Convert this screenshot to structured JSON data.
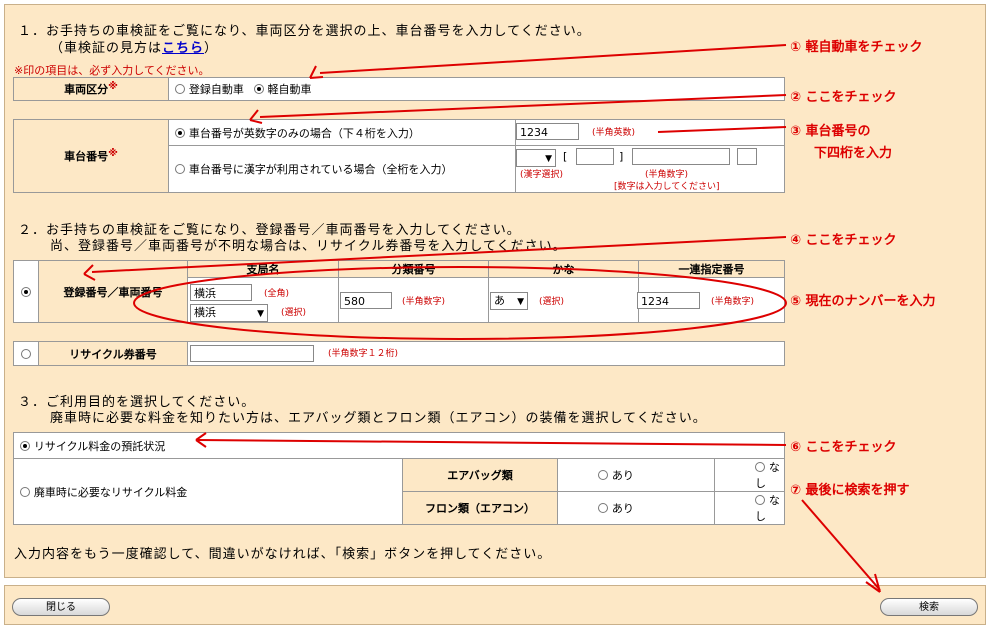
{
  "section1": {
    "title_line1": "１．お手持ちの車検証をご覧になり、車両区分を選択の上、車台番号を入力してください。",
    "title_line2_prefix": "（車検証の見方は",
    "title_line2_link": "こちら",
    "title_line2_suffix": "）",
    "required_note": "※印の項目は、必ず入力してください。",
    "vehicle_class": {
      "label": "車両区分",
      "req_mark": "※",
      "option_registered": "登録自動車",
      "option_kei": "軽自動車"
    },
    "chassis": {
      "label": "車台番号",
      "req_mark": "※",
      "option_alnum": "車台番号が英数字のみの場合（下４桁を入力）",
      "option_kanji": "車台番号に漢字が利用されている場合（全桁を入力）",
      "value": "1234",
      "hint_alnum": "(半角英数)",
      "bracket_open": "[",
      "bracket_close": "]",
      "hint_kanji": "(漢字選択)",
      "hint_numeric": "(半角数字)",
      "hint_no_char": "[数字は入力してください]"
    }
  },
  "section2": {
    "title_line1": "２．お手持ちの車検証をご覧になり、登録番号／車両番号を入力してください。",
    "title_line2": "尚、登録番号／車両番号が不明な場合は、リサイクル券番号を入力してください。",
    "reg_label": "登録番号／車両番号",
    "headers": [
      "支局名",
      "分類番号",
      "かな",
      "一連指定番号"
    ],
    "office_value": "横浜",
    "office_hint": "(全角)",
    "office_select": "横浜",
    "office_select_hint": "(選択)",
    "class_value": "580",
    "class_hint": "(半角数字)",
    "kana_select": "あ",
    "kana_hint": "(選択)",
    "serial_value": "1234",
    "serial_hint": "(半角数字)",
    "recycle_label": "リサイクル券番号",
    "recycle_hint": "(半角数字１２桁)"
  },
  "section3": {
    "title_line1": "３．ご利用目的を選択してください。",
    "title_line2": "廃車時に必要な料金を知りたい方は、エアバッグ類とフロン類（エアコン）の装備を選択してください。",
    "option_deposit": "リサイクル料金の預託状況",
    "option_scrap": "廃車時に必要なリサイクル料金",
    "airbag_label": "エアバッグ類",
    "freon_label": "フロン類（エアコン）",
    "yes": "あり",
    "no": "なし"
  },
  "confirm_text": "入力内容をもう一度確認して、間違いがなければ、「検索」ボタンを押してください。",
  "buttons": {
    "close": "閉じる",
    "search": "検索"
  },
  "annotations": {
    "a1": "① 軽自動車をチェック",
    "a2": "② ここをチェック",
    "a3_line1": "③ 車台番号の",
    "a3_line2": "下四桁を入力",
    "a4": "④ ここをチェック",
    "a5": "⑤ 現在のナンバーを入力",
    "a6": "⑥ ここをチェック",
    "a7": "⑦ 最後に検索を押す"
  },
  "colors": {
    "panel": "#fde8c6",
    "annotation": "#dd0000"
  }
}
